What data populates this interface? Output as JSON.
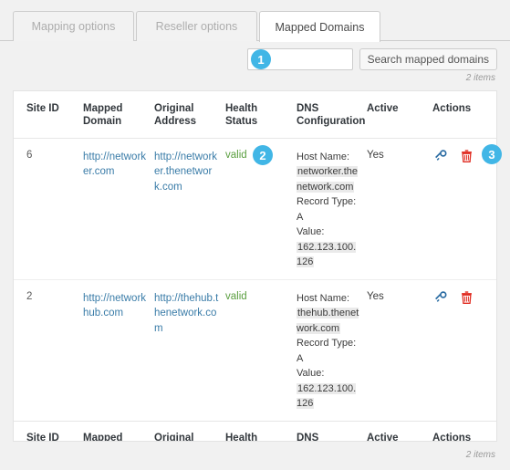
{
  "tabs": [
    {
      "label": "Mapping options",
      "active": false
    },
    {
      "label": "Reseller options",
      "active": false
    },
    {
      "label": "Mapped Domains",
      "active": true
    }
  ],
  "search": {
    "value": "",
    "placeholder": "",
    "button_label": "Search mapped domains"
  },
  "markers": {
    "one": "1",
    "two": "2",
    "three": "3"
  },
  "counts": {
    "top": "2 items",
    "bottom": "2 items"
  },
  "table": {
    "columns": [
      "Site ID",
      "Mapped Domain",
      "Original Address",
      "Health Status",
      "DNS Configuration",
      "Active",
      "Actions"
    ],
    "rows": [
      {
        "site_id": "6",
        "mapped_domain": "http://networker.com",
        "original_address": "http://networker.thenetwork.com",
        "health_status": "valid",
        "dns": {
          "host_label": "Host Name:",
          "host_value": "networker.thenetwork.com",
          "record_label": "Record Type:",
          "record_value": "A",
          "value_label": "Value:",
          "value_value": "162.123.100.126"
        },
        "active": "Yes",
        "actions": [
          "key-icon",
          "trash-icon"
        ]
      },
      {
        "site_id": "2",
        "mapped_domain": "http://networkhub.com",
        "original_address": "http://thehub.thenetwork.com",
        "health_status": "valid",
        "dns": {
          "host_label": "Host Name:",
          "host_value": "thehub.thenetwork.com",
          "record_label": "Record Type:",
          "record_value": "A",
          "value_label": "Value:",
          "value_value": "162.123.100.126"
        },
        "active": "Yes",
        "actions": [
          "key-icon",
          "trash-icon"
        ]
      }
    ]
  },
  "colors": {
    "marker_blue": "#41b6e6",
    "link_blue": "#3a7ca8",
    "valid_green": "#5a9e3f",
    "key_icon": "#2b6ca3",
    "trash_icon": "#e02b20",
    "page_bg": "#f1f1f1"
  }
}
